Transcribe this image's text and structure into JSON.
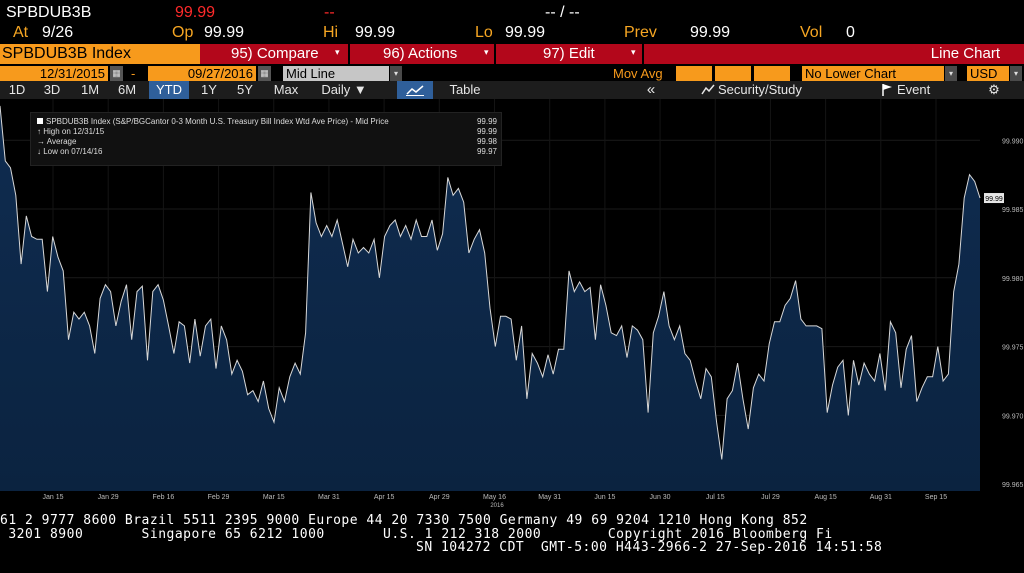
{
  "quote": {
    "ticker": "SPBDUB3B",
    "last": "99.99",
    "change": "--",
    "change_pct": "-- / --",
    "at_label": "At",
    "at_value": "9/26",
    "op_label": "Op",
    "op_value": "99.99",
    "hi_label": "Hi",
    "hi_value": "99.99",
    "lo_label": "Lo",
    "lo_value": "99.99",
    "prev_label": "Prev",
    "prev_value": "99.99",
    "vol_label": "Vol",
    "vol_value": "0"
  },
  "menubar": {
    "title": "SPBDUB3B Index",
    "compare_label": "95) Compare",
    "actions_label": "96) Actions",
    "edit_label": "97) Edit",
    "chart_type": "Line Chart"
  },
  "datebar": {
    "start_date": "12/31/2015",
    "dash": "-",
    "end_date": "09/27/2016",
    "price_type": "Mid Line",
    "mov_avg_label": "Mov Avg",
    "lower_chart": "No Lower Chart",
    "currency": "USD"
  },
  "rangebar": {
    "ranges": [
      "1D",
      "3D",
      "1M",
      "6M",
      "YTD",
      "1Y",
      "5Y",
      "Max"
    ],
    "active_range": "YTD",
    "period": "Daily ▼",
    "table_label": "Table",
    "collapse": "«",
    "security_study": "Security/Study",
    "event": "Event",
    "settings": "⚙"
  },
  "legend": {
    "title": "SPBDUB3B Index (S&P/BGCantor 0-3 Month U.S. Treasury Bill Index Wtd Ave Price) - Mid Price",
    "title_value": "99.99",
    "high_label": "High on 12/31/15",
    "high_value": "99.99",
    "avg_label": "Average",
    "avg_value": "99.98",
    "low_label": "Low on 07/14/16",
    "low_value": "99.97"
  },
  "chart_data": {
    "type": "area",
    "series": [
      {
        "name": "SPBDUB3B Index",
        "values": [
          99.9925,
          99.9885,
          99.988,
          99.986,
          99.981,
          99.9845,
          99.983,
          99.9828,
          99.9828,
          99.979,
          99.983,
          99.9815,
          99.9805,
          99.9755,
          99.9775,
          99.977,
          99.9775,
          99.9765,
          99.9745,
          99.9785,
          99.9795,
          99.979,
          99.9765,
          99.9783,
          99.9795,
          99.9755,
          99.979,
          99.9794,
          99.974,
          99.979,
          99.9795,
          99.9784,
          99.9765,
          99.9745,
          99.9768,
          99.9765,
          99.9738,
          99.977,
          99.9743,
          99.9765,
          99.977,
          99.9734,
          99.9765,
          99.9755,
          99.973,
          99.974,
          99.9732,
          99.9715,
          99.9718,
          99.971,
          99.9725,
          99.9705,
          99.9695,
          99.972,
          99.971,
          99.9728,
          99.9738,
          99.973,
          99.976,
          99.9862,
          99.984,
          99.983,
          99.9838,
          99.983,
          99.9842,
          99.9825,
          99.9808,
          99.9828,
          99.9818,
          99.9822,
          99.9818,
          99.9828,
          99.98,
          99.983,
          99.9838,
          99.9842,
          99.983,
          99.9838,
          99.9828,
          99.9842,
          99.983,
          99.983,
          99.9842,
          99.982,
          99.9832,
          99.9873,
          99.986,
          99.9865,
          99.9855,
          99.9818,
          99.9828,
          99.9835,
          99.9818,
          99.9778,
          99.975,
          99.9772,
          99.9772,
          99.977,
          99.974,
          99.9765,
          99.9712,
          99.9745,
          99.9738,
          99.9728,
          99.9744,
          99.973,
          99.9748,
          99.9748,
          99.9805,
          99.979,
          99.9797,
          99.979,
          99.9793,
          99.9755,
          99.9795,
          99.978,
          99.976,
          99.9758,
          99.9765,
          99.9742,
          99.9765,
          99.9762,
          99.9755,
          99.9702,
          99.976,
          99.9772,
          99.979,
          99.9765,
          99.9755,
          99.9765,
          99.9745,
          99.974,
          99.9725,
          99.9712,
          99.9734,
          99.9728,
          99.9695,
          99.9668,
          99.9712,
          99.9718,
          99.9738,
          99.9712,
          99.969,
          99.972,
          99.973,
          99.9725,
          99.9752,
          99.9768,
          99.9768,
          99.978,
          99.9785,
          99.9798,
          99.977,
          99.9765,
          99.9765,
          99.9765,
          99.9763,
          99.9702,
          99.9722,
          99.9735,
          99.974,
          99.97,
          99.974,
          99.9722,
          99.9738,
          99.973,
          99.9725,
          99.9745,
          99.9718,
          99.9768,
          99.976,
          99.972,
          99.9748,
          99.9758,
          99.971,
          99.972,
          99.9728,
          99.9728,
          99.975,
          99.9725,
          99.973,
          99.979,
          99.981,
          99.9858,
          99.9875,
          99.987,
          99.9858
        ]
      }
    ],
    "x_tick_labels": [
      "Jan 15",
      "Jan 29",
      "Feb 16",
      "Feb 29",
      "Mar 15",
      "Mar 31",
      "Apr 15",
      "Apr 29",
      "May 16",
      "May 31",
      "Jun 15",
      "Jun 30",
      "Jul 15",
      "Jul 29",
      "Aug 15",
      "Aug 31",
      "Sep 15"
    ],
    "x_sub_label": "2016",
    "y_tick_labels": [
      "99.990",
      "99.985",
      "99.980",
      "99.975",
      "99.970",
      "99.965"
    ],
    "y_ticks": [
      99.99,
      99.985,
      99.98,
      99.975,
      99.97,
      99.965
    ],
    "ylim": [
      99.9645,
      99.993
    ],
    "last_value_label": "99.99",
    "grid": true,
    "line_color": "#d8d8d8",
    "fill_color": "#0b2340"
  },
  "footer": {
    "line1": "61 2 9777 8600 Brazil 5511 2395 9000 Europe 44 20 7330 7500 Germany 49 69 9204 1210 Hong Kong 852",
    "line2": " 3201 8900       Singapore 65 6212 1000       U.S. 1 212 318 2000        Copyright 2016 Bloomberg Fi",
    "line3": "SN 104272 CDT  GMT-5:00 H443-2966-2 27-Sep-2016 14:51:58"
  },
  "colors": {
    "accent_orange": "#f79a1c",
    "menu_red": "#b3071b",
    "active_blue": "#2f5f9a"
  }
}
